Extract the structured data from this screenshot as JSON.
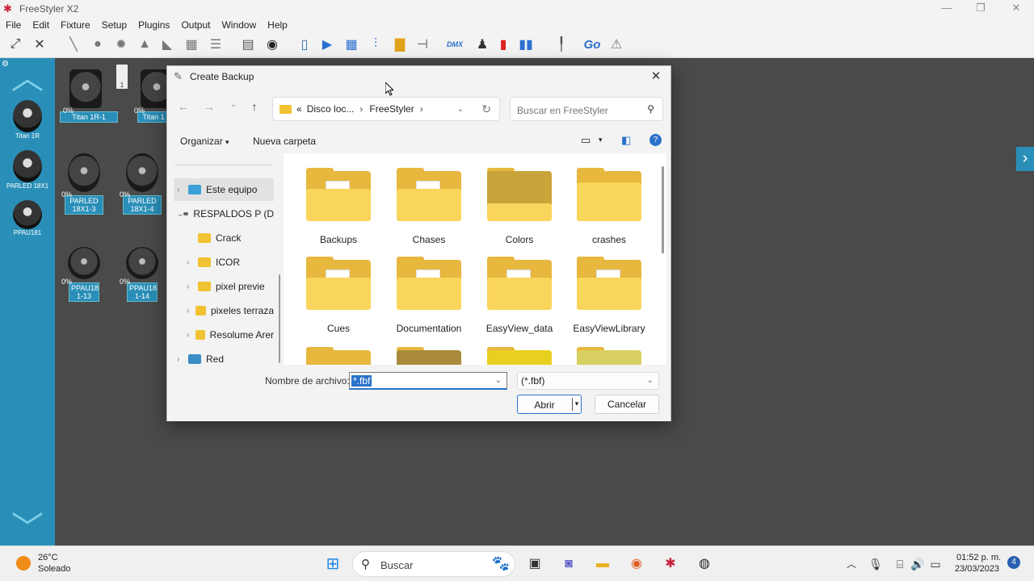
{
  "app": {
    "title": "FreeStyler X2",
    "window_controls": [
      "—",
      "❐",
      "✕"
    ]
  },
  "menu": [
    "File",
    "Edit",
    "Fixture",
    "Setup",
    "Plugins",
    "Output",
    "Window",
    "Help"
  ],
  "toolbar": {
    "go_label": "Go",
    "dmx_label": "DMX"
  },
  "left_panel": {
    "items": [
      {
        "label": "Titan 1R"
      },
      {
        "label": "PARLED 18X1"
      },
      {
        "label": "PPAU181"
      }
    ]
  },
  "workspace": {
    "palette_number": "1",
    "fixtures": [
      {
        "pct": "0%",
        "label": "Titan 1R-1"
      },
      {
        "pct": "0%",
        "label": "Titan 1"
      },
      {
        "pct": "0%",
        "label": "PARLED 18X1-3"
      },
      {
        "pct": "0%",
        "label": "PARLED 18X1-4"
      },
      {
        "pct": "0%",
        "label": "PPAU18 1-13"
      },
      {
        "pct": "0%",
        "label": "PPAU18 1-14"
      }
    ]
  },
  "dialog": {
    "title": "Create Backup",
    "close": "✕",
    "address": {
      "prefix": "«",
      "segments": [
        "Disco loc...",
        "FreeStyler"
      ]
    },
    "search_placeholder": "Buscar en FreeStyler",
    "commands": {
      "organize": "Organizar",
      "new_folder": "Nueva carpeta"
    },
    "nav": [
      {
        "label": "Este equipo",
        "expand": "›",
        "type": "pc",
        "selected": true
      },
      {
        "label": "RESPALDOS P (D",
        "expand": "⌄",
        "type": "drive"
      },
      {
        "label": "Crack",
        "expand": "",
        "type": "folder"
      },
      {
        "label": "ICOR",
        "expand": "›",
        "type": "folder"
      },
      {
        "label": "pixel previe",
        "expand": "›",
        "type": "folder"
      },
      {
        "label": "pixeles terraza",
        "expand": "›",
        "type": "folder"
      },
      {
        "label": "Resolume Arer",
        "expand": "›",
        "type": "folder"
      },
      {
        "label": "Red",
        "expand": "›",
        "type": "network"
      }
    ],
    "files": [
      {
        "name": "Backups",
        "style": "paper"
      },
      {
        "name": "Chases",
        "style": "paper"
      },
      {
        "name": "Colors",
        "style": "dark"
      },
      {
        "name": "crashes",
        "style": "empty"
      },
      {
        "name": "Cues",
        "style": "paper"
      },
      {
        "name": "Documentation",
        "style": "paper"
      },
      {
        "name": "EasyView_data",
        "style": "paper"
      },
      {
        "name": "EasyViewLibrary",
        "style": "paper"
      }
    ],
    "filename_label": "Nombre de archivo:",
    "filename_value": "*.fbf",
    "filetype_value": "(*.fbf)",
    "open_button": "Abrir",
    "cancel_button": "Cancelar"
  },
  "taskbar": {
    "weather_temp": "26°C",
    "weather_desc": "Soleado",
    "search_label": "Buscar",
    "time": "01:52 p. m.",
    "date": "23/03/2023",
    "notifications": "4"
  }
}
